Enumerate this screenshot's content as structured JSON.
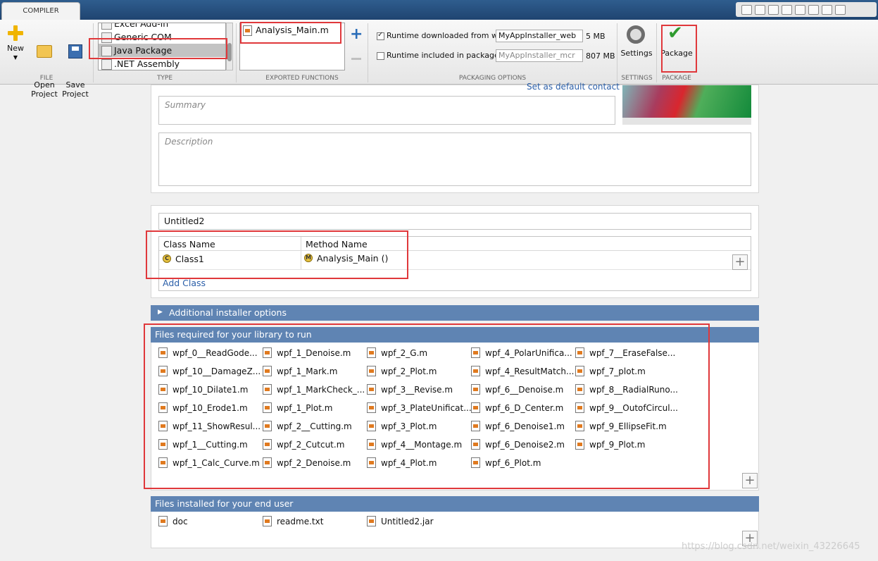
{
  "tab": "COMPILER",
  "file_group": {
    "label": "FILE",
    "new": "New",
    "open": "Open\nProject",
    "save": "Save\nProject"
  },
  "type_group": {
    "label": "TYPE",
    "items": [
      "Excel Add-in",
      "Generic COM Component",
      "Java Package",
      ".NET Assembly"
    ]
  },
  "exported": {
    "label": "EXPORTED FUNCTIONS",
    "item": "Analysis_Main.m"
  },
  "packaging": {
    "label": "PACKAGING OPTIONS",
    "web_label": "Runtime downloaded from web",
    "web_value": "MyAppInstaller_web",
    "web_size": "5 MB",
    "pkg_label": "Runtime included in package",
    "pkg_value": "MyAppInstaller_mcr",
    "pkg_size": "807 MB"
  },
  "settings": {
    "label": "SETTINGS",
    "button": "Settings"
  },
  "package": {
    "label": "PACKAGE",
    "button": "Package"
  },
  "info": {
    "default_contact": "Set as default contact",
    "summary_ph": "Summary",
    "description_ph": "Description"
  },
  "class_section": {
    "name": "Untitled2",
    "col_class": "Class Name",
    "col_method": "Method Name",
    "class1": "Class1",
    "method1": "Analysis_Main ()",
    "add_class": "Add Class"
  },
  "additional": "Additional installer options",
  "required": {
    "header": "Files required for your library to run",
    "files": [
      [
        "wpf_0__ReadGode...",
        "wpf_1_Denoise.m",
        "wpf_2_G.m",
        "wpf_4_PolarUnifica...",
        "wpf_7__EraseFalse..."
      ],
      [
        "wpf_10__DamageZ...",
        "wpf_1_Mark.m",
        "wpf_2_Plot.m",
        "wpf_4_ResultMatch...",
        "wpf_7_plot.m"
      ],
      [
        "wpf_10_Dilate1.m",
        "wpf_1_MarkCheck_...",
        "wpf_3__Revise.m",
        "wpf_6__Denoise.m",
        "wpf_8__RadialRuno..."
      ],
      [
        "wpf_10_Erode1.m",
        "wpf_1_Plot.m",
        "wpf_3_PlateUnificat...",
        "wpf_6_D_Center.m",
        "wpf_9__OutofCircul..."
      ],
      [
        "wpf_11_ShowResul...",
        "wpf_2__Cutting.m",
        "wpf_3_Plot.m",
        "wpf_6_Denoise1.m",
        "wpf_9_EllipseFit.m"
      ],
      [
        "wpf_1__Cutting.m",
        "wpf_2_Cutcut.m",
        "wpf_4__Montage.m",
        "wpf_6_Denoise2.m",
        "wpf_9_Plot.m"
      ],
      [
        "wpf_1_Calc_Curve.m",
        "wpf_2_Denoise.m",
        "wpf_4_Plot.m",
        "wpf_6_Plot.m",
        ""
      ]
    ]
  },
  "installed": {
    "header": "Files installed for your end user",
    "files": [
      "doc",
      "readme.txt",
      "Untitled2.jar"
    ]
  },
  "watermark": "https://blog.csdn.net/weixin_43226645"
}
